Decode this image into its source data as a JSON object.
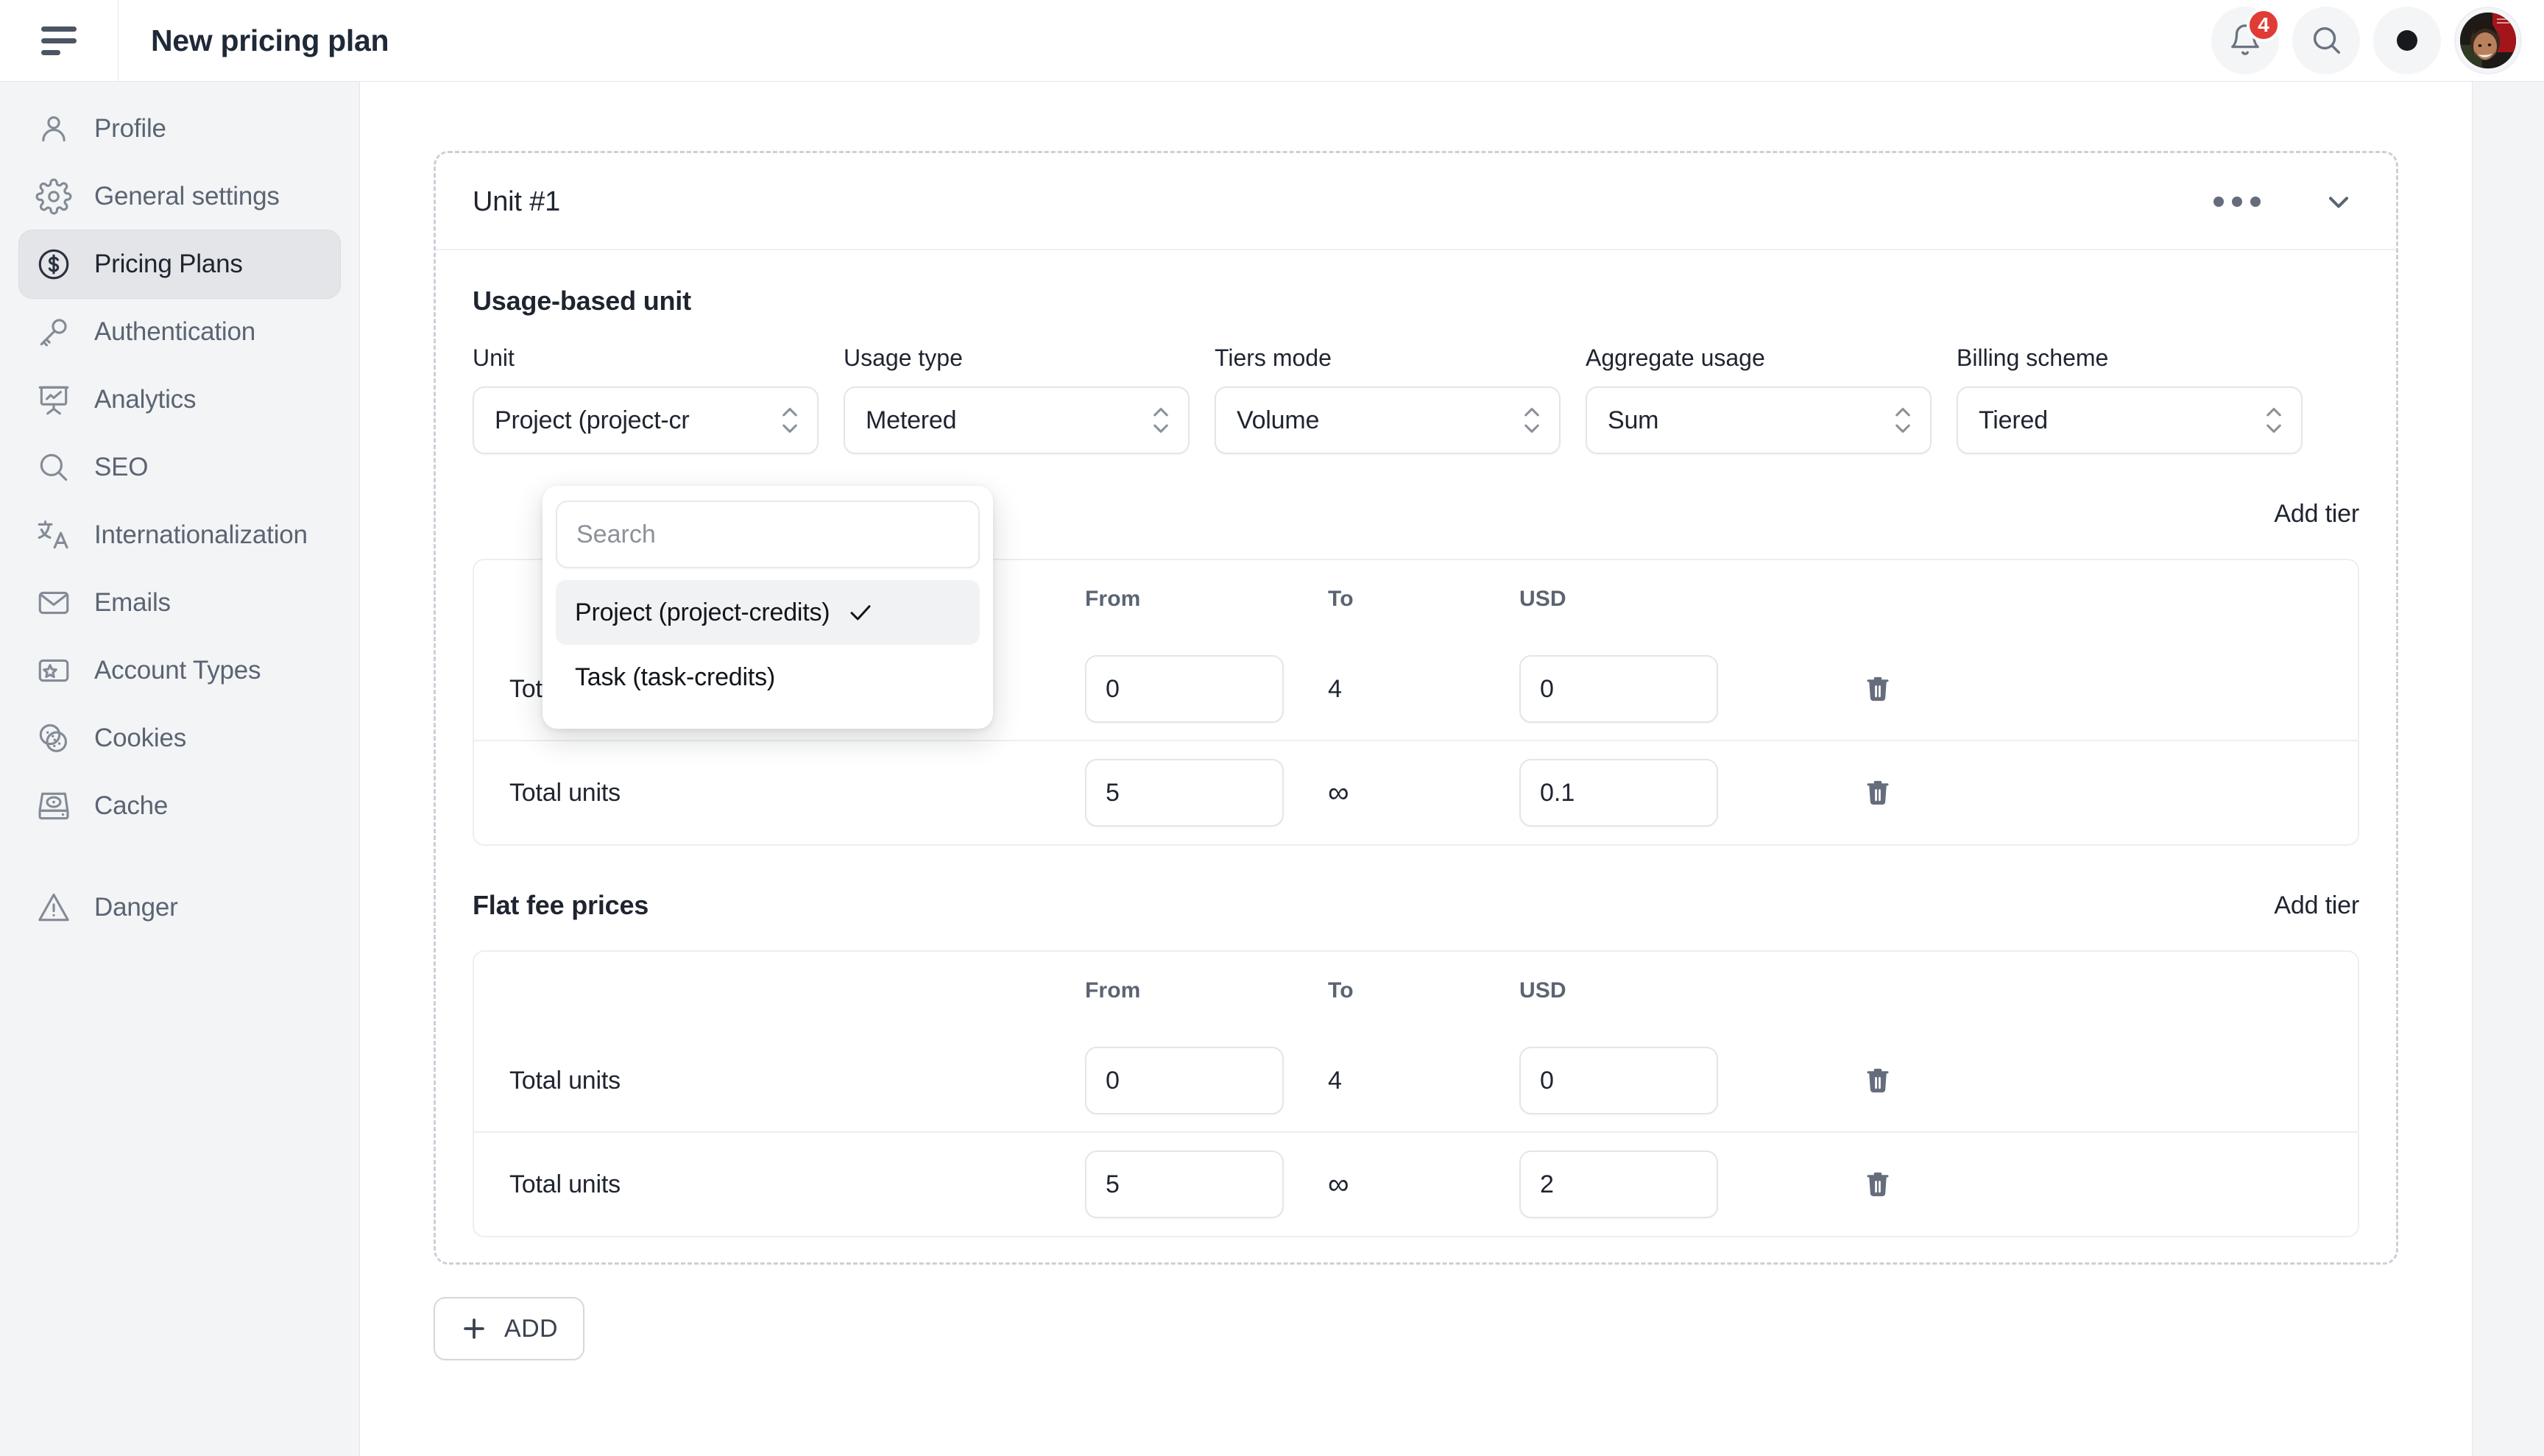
{
  "header": {
    "title": "New pricing plan",
    "menu_icon": "hamburger-icon",
    "notifications": {
      "icon": "bell-icon",
      "count": "4"
    },
    "search_icon": "search-icon",
    "theme_icon": "theme-dot-icon",
    "avatar": "user-avatar"
  },
  "sidebar": {
    "items": [
      {
        "label": "Profile",
        "icon": "user-icon",
        "active": false
      },
      {
        "label": "General settings",
        "icon": "gear-icon",
        "active": false
      },
      {
        "label": "Pricing Plans",
        "icon": "dollar-circle-icon",
        "active": true
      },
      {
        "label": "Authentication",
        "icon": "key-icon",
        "active": false
      },
      {
        "label": "Analytics",
        "icon": "presentation-chart-icon",
        "active": false
      },
      {
        "label": "SEO",
        "icon": "magnifier-icon",
        "active": false
      },
      {
        "label": "Internationalization",
        "icon": "translate-icon",
        "active": false
      },
      {
        "label": "Emails",
        "icon": "envelope-icon",
        "active": false
      },
      {
        "label": "Account Types",
        "icon": "star-card-icon",
        "active": false
      },
      {
        "label": "Cookies",
        "icon": "cookie-icon",
        "active": false
      },
      {
        "label": "Cache",
        "icon": "disk-icon",
        "active": false
      }
    ],
    "danger": {
      "label": "Danger",
      "icon": "warning-triangle-icon"
    }
  },
  "unit_card": {
    "title": "Unit #1",
    "more_icon": "ellipsis-icon",
    "collapse_icon": "chevron-down-icon",
    "section_title": "Usage-based unit",
    "fields": [
      {
        "label": "Unit",
        "value": "Project (project-cr"
      },
      {
        "label": "Usage type",
        "value": "Metered"
      },
      {
        "label": "Tiers mode",
        "value": "Volume"
      },
      {
        "label": "Aggregate usage",
        "value": "Sum"
      },
      {
        "label": "Billing scheme",
        "value": "Tiered"
      }
    ],
    "dropdown": {
      "search_placeholder": "Search",
      "search_value": "",
      "options": [
        {
          "label": "Project (project-credits)",
          "selected": true
        },
        {
          "label": "Task (task-credits)",
          "selected": false
        }
      ],
      "check_icon": "check-icon"
    },
    "usage_tiers": {
      "add_label": "Add tier",
      "columns": [
        "",
        "From",
        "To",
        "USD",
        ""
      ],
      "rows": [
        {
          "name": "Total units",
          "from": "0",
          "to": "4",
          "usd": "0",
          "delete_icon": "trash-icon"
        },
        {
          "name": "Total units",
          "from": "5",
          "to": "∞",
          "usd": "0.1",
          "delete_icon": "trash-icon"
        }
      ]
    },
    "flat_fee": {
      "title": "Flat fee prices",
      "add_label": "Add tier",
      "columns": [
        "",
        "From",
        "To",
        "USD",
        ""
      ],
      "rows": [
        {
          "name": "Total units",
          "from": "0",
          "to": "4",
          "usd": "0",
          "delete_icon": "trash-icon"
        },
        {
          "name": "Total units",
          "from": "5",
          "to": "∞",
          "usd": "2",
          "delete_icon": "trash-icon"
        }
      ]
    }
  },
  "add_button": {
    "label": "ADD",
    "icon": "plus-icon"
  },
  "colors": {
    "accent_badge": "#e03b34",
    "sidebar_bg": "#f3f4f6",
    "active_item_bg": "#e3e5e9",
    "text_primary": "#1f2430",
    "text_muted": "#5b6472",
    "border": "#e3e5e9"
  }
}
